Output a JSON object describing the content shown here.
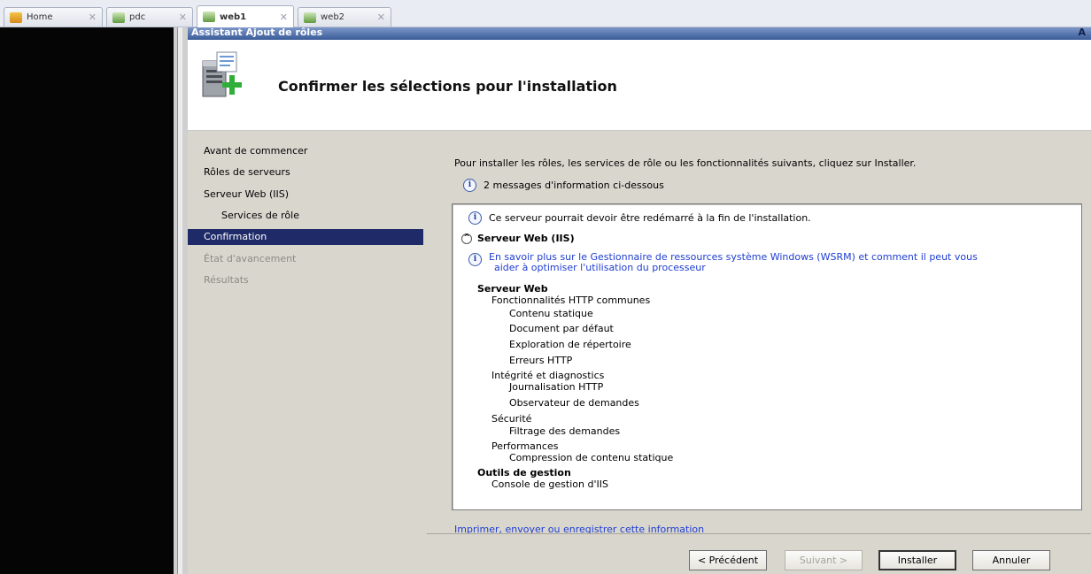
{
  "tabs": [
    {
      "label": "Home",
      "icon": "home-icon",
      "active": false
    },
    {
      "label": "pdc",
      "icon": "vm-icon",
      "active": false
    },
    {
      "label": "web1",
      "icon": "vm-icon",
      "active": true
    },
    {
      "label": "web2",
      "icon": "vm-icon",
      "active": false
    }
  ],
  "tab_close_glyph": "✕",
  "window": {
    "title": "Assistant Ajout de rôles",
    "title_right": "A"
  },
  "header": {
    "heading": "Confirmer les sélections pour l'installation",
    "icon": "server-add-icon"
  },
  "nav": {
    "items": [
      {
        "label": "Avant de commencer",
        "state": "normal"
      },
      {
        "label": "Rôles de serveurs",
        "state": "normal"
      },
      {
        "label": "Serveur Web (IIS)",
        "state": "normal"
      },
      {
        "label": "Services de rôle",
        "state": "normal"
      },
      {
        "label": "Confirmation",
        "state": "selected"
      },
      {
        "label": "État d'avancement",
        "state": "disabled"
      },
      {
        "label": "Résultats",
        "state": "disabled"
      }
    ]
  },
  "content": {
    "intro": "Pour installer les rôles, les services de rôle ou les fonctionnalités suivants, cliquez sur Installer.",
    "info_count_message": "2 messages d'information ci-dessous",
    "restart_message": "Ce serveur pourrait devoir être redémarré à la fin de l'installation.",
    "section_title": "Serveur Web (IIS)",
    "wsrm_link_line1": "En savoir plus sur le Gestionnaire de ressources système Windows (WSRM) et comment il peut vous",
    "wsrm_link_line2": "aider à optimiser l'utilisation du processeur",
    "tree": {
      "serveur_web": "Serveur Web",
      "http_common": "Fonctionnalités HTTP communes",
      "static_content": "Contenu statique",
      "default_doc": "Document par défaut",
      "dir_browse": "Exploration de répertoire",
      "http_errors": "Erreurs HTTP",
      "health": "Intégrité et diagnostics",
      "http_logging": "Journalisation HTTP",
      "request_monitor": "Observateur de demandes",
      "security": "Sécurité",
      "request_filtering": "Filtrage des demandes",
      "performance": "Performances",
      "static_compression": "Compression de contenu statique",
      "mgmt_tools": "Outils de gestion",
      "iis_console": "Console de gestion d'IIS"
    },
    "print_link": "Imprimer, envoyer ou enregistrer cette information"
  },
  "buttons": {
    "previous": "< Précédent",
    "next": "Suivant >",
    "install": "Installer",
    "cancel": "Annuler"
  },
  "colors": {
    "selected_nav_bg": "#1f2b68",
    "pane_bg": "#d9d6ce",
    "link": "#1e3dd1",
    "title_bar": "#3b5c99"
  }
}
